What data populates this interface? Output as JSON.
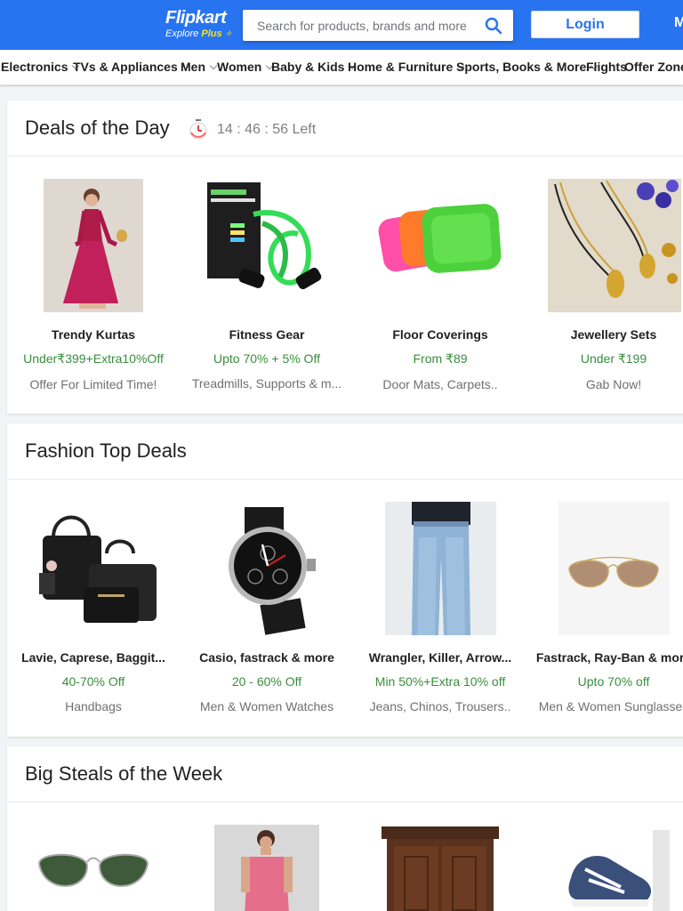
{
  "header": {
    "logo_name": "Flipkart",
    "logo_explore": "Explore",
    "logo_plus": "Plus",
    "search_placeholder": "Search for products, brands and more",
    "login_label": "Login",
    "more_label": "More",
    "brand_color": "#2874f0",
    "accent_color": "#ffe500"
  },
  "nav": [
    {
      "label": "Electronics",
      "has_dropdown": true
    },
    {
      "label": "TVs & Appliances",
      "has_dropdown": true
    },
    {
      "label": "Men",
      "has_dropdown": true
    },
    {
      "label": "Women",
      "has_dropdown": true
    },
    {
      "label": "Baby & Kids",
      "has_dropdown": true
    },
    {
      "label": "Home & Furniture",
      "has_dropdown": true
    },
    {
      "label": "Sports, Books & More",
      "has_dropdown": true
    },
    {
      "label": "Flights",
      "has_dropdown": false
    },
    {
      "label": "Offer Zone",
      "has_dropdown": false
    }
  ],
  "deals": {
    "title": "Deals of the Day",
    "timer": "14 : 46 : 56 Left",
    "items": [
      {
        "name": "Trendy Kurtas",
        "offer": "Under₹399+Extra10%Off",
        "sub": "Offer For Limited Time!"
      },
      {
        "name": "Fitness Gear",
        "offer": "Upto 70% + 5% Off",
        "sub": "Treadmills, Supports & m..."
      },
      {
        "name": "Floor Coverings",
        "offer": "From ₹89",
        "sub": "Door Mats, Carpets.."
      },
      {
        "name": "Jewellery Sets",
        "offer": "Under ₹199",
        "sub": "Gab Now!"
      }
    ]
  },
  "fashion": {
    "title": "Fashion Top Deals",
    "items": [
      {
        "name": "Lavie, Caprese, Baggit...",
        "offer": "40-70% Off",
        "sub": "Handbags"
      },
      {
        "name": "Casio, fastrack & more",
        "offer": "20 - 60% Off",
        "sub": "Men & Women Watches"
      },
      {
        "name": "Wrangler, Killer, Arrow...",
        "offer": "Min 50%+Extra 10% off",
        "sub": "Jeans, Chinos, Trousers.."
      },
      {
        "name": "Fastrack, Ray-Ban & more",
        "offer": "Upto 70% off",
        "sub": "Men & Women Sunglasses"
      }
    ]
  },
  "steals": {
    "title": "Big Steals of the Week"
  },
  "colors": {
    "offer_green": "#388e3c",
    "muted_text": "#707070",
    "page_bg": "#f1f3f6"
  }
}
